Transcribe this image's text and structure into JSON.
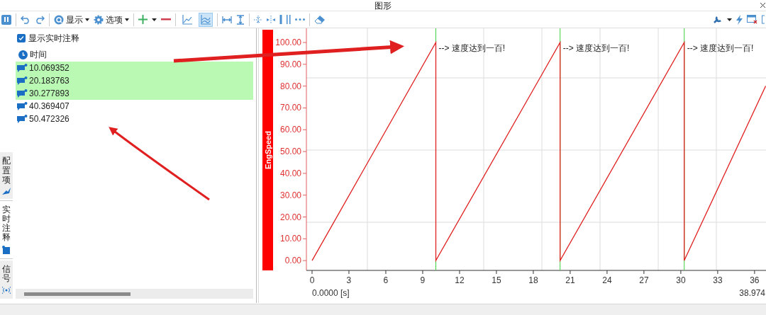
{
  "window": {
    "title": "图形"
  },
  "toolbar": {
    "display_menu": "显示",
    "options_menu": "选项",
    "view_toggles": [
      {
        "selected": false
      },
      {
        "selected": true
      }
    ]
  },
  "side_tabs": [
    {
      "label": "配置项",
      "selected": false
    },
    {
      "label": "实时注释",
      "selected": true
    },
    {
      "label": "信号",
      "selected": false
    }
  ],
  "annotations_panel": {
    "show_live": {
      "label": "显示实时注释",
      "checked": true
    },
    "column": "时间",
    "rows": [
      {
        "time": "10.069352",
        "selected": true
      },
      {
        "time": "20.183763",
        "selected": true
      },
      {
        "time": "30.277893",
        "selected": true
      },
      {
        "time": "40.369407",
        "selected": false
      },
      {
        "time": "50.472326",
        "selected": false
      }
    ]
  },
  "chart": {
    "start_label": "0.0000 [s]",
    "end_label": "38.974",
    "chart_data": {
      "type": "line",
      "ylabel": "EngSpeed",
      "xlim": [
        -0.46,
        36.93
      ],
      "ylim": [
        -4.5,
        106.5
      ],
      "ref_lines": [
        {
          "axis": "x",
          "value": 10.07,
          "color": "#40d040"
        },
        {
          "axis": "x",
          "value": 20.18,
          "color": "#40d040"
        },
        {
          "axis": "x",
          "value": 30.28,
          "color": "#40d040"
        }
      ],
      "x": [
        0,
        10.07,
        10.07,
        20.18,
        20.18,
        30.28,
        30.28,
        36.9
      ],
      "series": [
        {
          "color": "#e02020",
          "values": [
            0,
            100,
            0,
            100,
            0,
            100,
            0,
            80
          ]
        }
      ],
      "xticks": [
        0,
        3,
        6,
        9,
        12,
        15,
        18,
        21,
        24,
        27,
        30,
        33,
        36
      ],
      "yticks": [
        {
          "value": 0,
          "label": "0.00"
        },
        {
          "value": 10,
          "label": "10.00"
        },
        {
          "value": 20,
          "label": "20.00"
        },
        {
          "value": 30,
          "label": "30.00"
        },
        {
          "value": 40,
          "label": "40.00"
        },
        {
          "value": 50,
          "label": "50.00"
        },
        {
          "value": 60,
          "label": "60.00"
        },
        {
          "value": 70,
          "label": "70.00"
        },
        {
          "value": 80,
          "label": "80.00"
        },
        {
          "value": 90,
          "label": "90.00"
        },
        {
          "value": 100,
          "label": "100.00"
        }
      ],
      "annotations": [
        {
          "x": 10.07,
          "y": 100,
          "text": "--> 速度达到一百!"
        },
        {
          "x": 20.18,
          "y": 100,
          "text": "--> 速度达到一百!"
        },
        {
          "x": 30.28,
          "y": 100,
          "text": "--> 速度达到一百!"
        }
      ]
    }
  }
}
